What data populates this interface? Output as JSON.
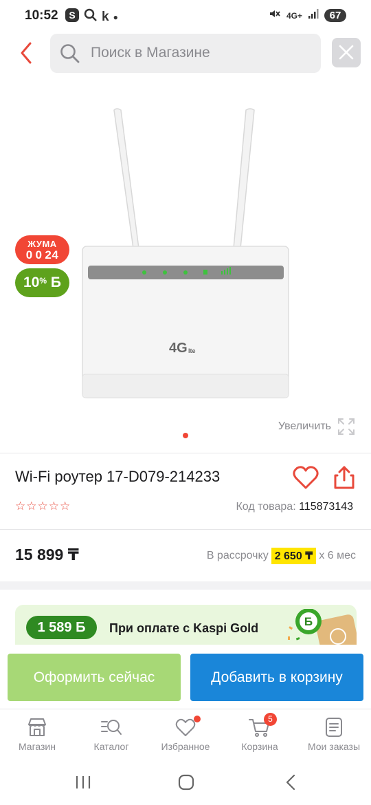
{
  "status_bar": {
    "time": "10:52",
    "left_icons": [
      "S",
      "k"
    ],
    "network": "4G+",
    "battery": "67"
  },
  "search": {
    "placeholder": "Поиск в Магазине"
  },
  "gallery": {
    "badge_day": "ЖУМА",
    "badge_countdown": "0 0 24",
    "discount": "10",
    "discount_unit": "%",
    "discount_suffix": "Б",
    "zoom_label": "Увеличить",
    "page_count": 1,
    "active_page": 1,
    "router_label": "4G",
    "router_label_small": "lte"
  },
  "product": {
    "title": "Wi-Fi роутер 17-D079-214233",
    "rating_stars": 0,
    "rating_max": 5,
    "code_label": "Код товара:",
    "code_value": "115873143"
  },
  "price": {
    "value": "15 899 ₸",
    "installment_label": "В рассрочку",
    "installment_amount": "2 650 ₸",
    "installment_term": "х 6 мес"
  },
  "promo": {
    "bonus": "1 589 Б",
    "text": "При оплате с Kaspi Gold",
    "logo_letter": "Б"
  },
  "actions": {
    "buy_now": "Оформить сейчас",
    "add_to_cart": "Добавить в корзину"
  },
  "bottom_nav": {
    "items": [
      {
        "label": "Магазин",
        "icon": "store-icon"
      },
      {
        "label": "Каталог",
        "icon": "catalog-search-icon"
      },
      {
        "label": "Избранное",
        "icon": "heart-icon",
        "dot": true
      },
      {
        "label": "Корзина",
        "icon": "cart-icon",
        "count": "5"
      },
      {
        "label": "Мои заказы",
        "icon": "orders-icon"
      }
    ]
  },
  "colors": {
    "accent_red": "#f14635",
    "kaspi_green": "#5ea21c",
    "cart_blue": "#1a86d9",
    "buy_now_green": "#a7d876",
    "installment_yellow": "#ffe500"
  }
}
